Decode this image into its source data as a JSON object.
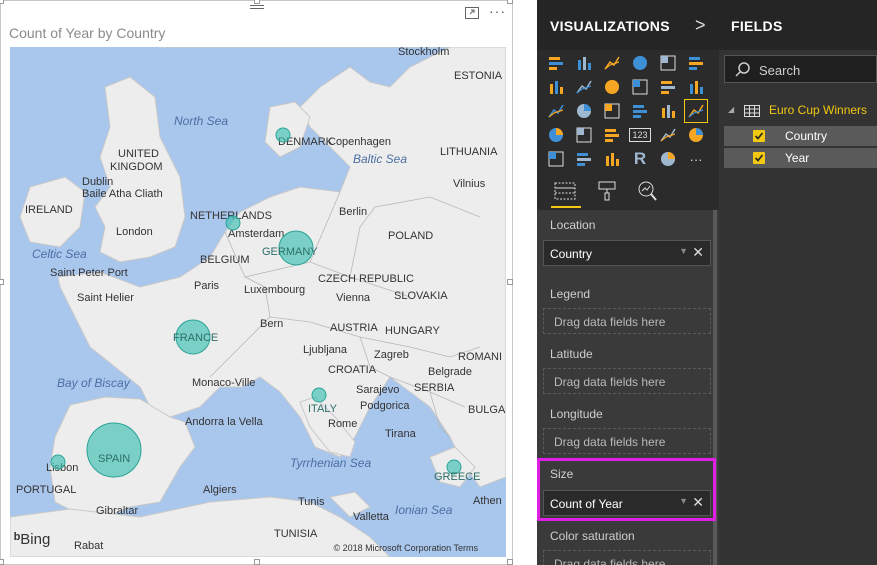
{
  "visual": {
    "title": "Count of Year by Country",
    "attribution": "Bing",
    "copyright": "© 2018 Microsoft Corporation  Terms",
    "more_icon": "more-options-icon",
    "focus_icon": "focus-mode-icon"
  },
  "map": {
    "seas": [
      "North Sea",
      "Baltic Sea",
      "Celtic Sea",
      "Bay of Biscay",
      "Tyrrhenian Sea",
      "Ionian Sea"
    ],
    "places": [
      "Stockholm",
      "ESTONIA",
      "DENMARK",
      "Copenhagen",
      "UNITED KINGDOM",
      "Dublin",
      "Baile Atha Cliath",
      "IRELAND",
      "London",
      "NETHERLANDS",
      "Amsterdam",
      "BELGIUM",
      "Berlin",
      "POLAND",
      "LITHUANIA",
      "Vilnius",
      "Saint Peter Port",
      "Saint Helier",
      "Paris",
      "Luxembourg",
      "CZECH REPUBLIC",
      "Vienna",
      "SLOVAKIA",
      "AUSTRIA",
      "HUNGARY",
      "Bern",
      "Ljubljana",
      "Zagreb",
      "ROMANI",
      "CROATIA",
      "Belgrade",
      "Monaco-Ville",
      "Sarajevo",
      "SERBIA",
      "Podgorica",
      "BULGAR",
      "Andorra la Vella",
      "Rome",
      "Tirana",
      "Lisbon",
      "PORTUGAL",
      "Algiers",
      "Tunis",
      "Valletta",
      "Gibraltar",
      "TUNISIA",
      "Rabat",
      "Athen"
    ],
    "bubbles": [
      {
        "country": "GERMANY",
        "count": 3
      },
      {
        "country": "FRANCE",
        "count": 2
      },
      {
        "country": "SPAIN",
        "count": 3
      },
      {
        "country": "DENMARK",
        "count": 1
      },
      {
        "country": "NETHERLANDS",
        "count": 1
      },
      {
        "country": "ITALY",
        "count": 1
      },
      {
        "country": "PORTUGAL",
        "count": 1
      },
      {
        "country": "GREECE",
        "count": 1
      }
    ]
  },
  "visualizations": {
    "title": "VISUALIZATIONS",
    "chevron": ">",
    "icons": [
      "stacked-bar-icon",
      "stacked-column-icon",
      "clustered-bar-icon",
      "clustered-column-icon",
      "100-bar-icon",
      "100-column-icon",
      "line-icon",
      "area-icon",
      "stacked-area-icon",
      "line-column-icon",
      "line-clustered-icon",
      "ribbon-icon",
      "waterfall-icon",
      "scatter-icon",
      "pie-icon",
      "donut-icon",
      "treemap-icon",
      "map-icon",
      "filled-map-icon",
      "funnel-icon",
      "gauge-icon",
      "card-icon",
      "multirow-card-icon",
      "kpi-icon",
      "slicer-icon",
      "table-icon",
      "matrix-icon",
      "r-visual-icon",
      "globe-icon",
      "more-icon"
    ],
    "r_label": "R",
    "card_label": "123",
    "more_label": "···",
    "tabs": [
      "fields-tab-icon",
      "format-paint-icon",
      "analytics-icon"
    ],
    "wells": {
      "location_label": "Location",
      "location_value": "Country",
      "legend_label": "Legend",
      "legend_placeholder": "Drag data fields here",
      "latitude_label": "Latitude",
      "latitude_placeholder": "Drag data fields here",
      "longitude_label": "Longitude",
      "longitude_placeholder": "Drag data fields here",
      "size_label": "Size",
      "size_value": "Count of Year",
      "color_label": "Color saturation",
      "color_placeholder": "Drag data fields here"
    },
    "remove_glyph": "✕",
    "dropdown_glyph": "▼"
  },
  "fields": {
    "title": "FIELDS",
    "search_placeholder": "Search",
    "table_name": "Euro Cup Winners",
    "expand_glyph": "◢",
    "items": [
      {
        "name": "Country",
        "checked": true
      },
      {
        "name": "Year",
        "checked": true
      }
    ]
  },
  "colors": {
    "accent": "#f2c811",
    "highlight": "#e11ee6",
    "bubble": "#3cc0b2",
    "pane_bg": "#2b2b2b",
    "water": "#a9c6ec",
    "land": "#ededed"
  }
}
